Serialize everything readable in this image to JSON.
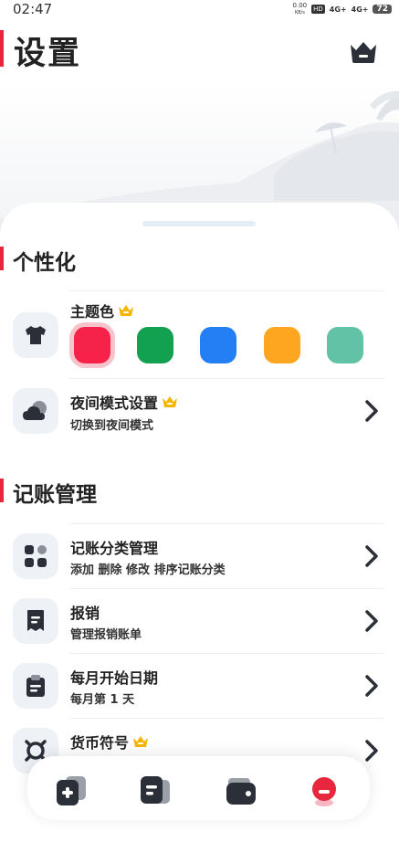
{
  "status_bar": {
    "time": "02:47",
    "net_speed": "0.00",
    "net_unit": "KB/s",
    "hd": "HD",
    "sim1": "4G+",
    "sim2": "4G+",
    "battery": "72"
  },
  "header": {
    "title": "设置",
    "crown_icon": "crown-icon"
  },
  "sections": {
    "personalization": {
      "title": "个性化",
      "theme_color": {
        "label": "主题色",
        "swatches": [
          "#f7224a",
          "#12a150",
          "#247ff5",
          "#ffa621",
          "#62c2a6"
        ],
        "selected": "#f7224a"
      },
      "night_mode": {
        "title": "夜间模式设置",
        "subtitle": "切换到夜间模式"
      }
    },
    "bookkeeping": {
      "title": "记账管理",
      "category": {
        "title": "记账分类管理",
        "subtitle": "添加 删除 修改 排序记账分类"
      },
      "reimburse": {
        "title": "报销",
        "subtitle": "管理报销账单"
      },
      "month_start": {
        "title": "每月开始日期",
        "subtitle": "每月第 1 天"
      },
      "currency": {
        "title": "货币符号"
      }
    }
  },
  "colors": {
    "accent": "#e8263e",
    "icon_dark": "#2b2f38",
    "premium": "#f5b500"
  }
}
